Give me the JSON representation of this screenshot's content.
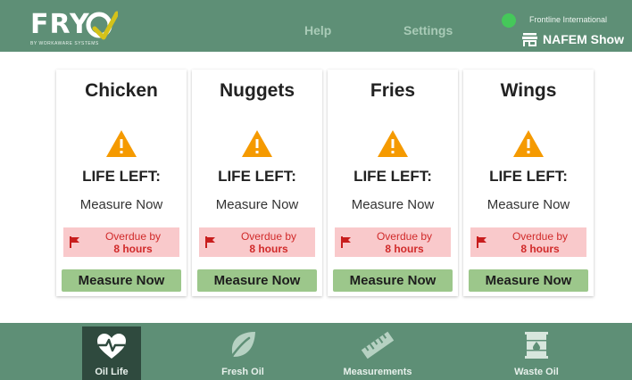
{
  "header": {
    "logo_text": "FRY",
    "logo_tagline": "BY WORKAWARE SYSTEMS",
    "nav": {
      "help": "Help",
      "settings": "Settings"
    },
    "org_name": "Frontline International",
    "store_name": "NAFEM Show",
    "status_color": "#45c85a"
  },
  "cards": [
    {
      "title": "Chicken",
      "life_label": "LIFE LEFT:",
      "life_value": "Measure Now",
      "overdue_label": "Overdue by",
      "overdue_value": "8 hours",
      "button": "Measure Now"
    },
    {
      "title": "Nuggets",
      "life_label": "LIFE LEFT:",
      "life_value": "Measure Now",
      "overdue_label": "Overdue by",
      "overdue_value": "8 hours",
      "button": "Measure Now"
    },
    {
      "title": "Fries",
      "life_label": "LIFE LEFT:",
      "life_value": "Measure Now",
      "overdue_label": "Overdue by",
      "overdue_value": "8 hours",
      "button": "Measure Now"
    },
    {
      "title": "Wings",
      "life_label": "LIFE LEFT:",
      "life_value": "Measure Now",
      "overdue_label": "Overdue by",
      "overdue_value": "8 hours",
      "button": "Measure Now"
    }
  ],
  "bottom_nav": [
    {
      "label": "Oil Life",
      "icon": "heartbeat-icon",
      "active": true
    },
    {
      "label": "Fresh Oil",
      "icon": "leaf-icon",
      "active": false
    },
    {
      "label": "Measurements",
      "icon": "ruler-icon",
      "active": false
    },
    {
      "label": "Waste Oil",
      "icon": "oil-drum-icon",
      "active": false
    }
  ],
  "colors": {
    "header_bg": "#5e8f76",
    "nav_active_bg": "#2f4a3e",
    "warning": "#f59a00",
    "overdue_bg": "#f9c9cb",
    "overdue_text": "#d12a2a",
    "button_bg": "#9cc78b"
  }
}
